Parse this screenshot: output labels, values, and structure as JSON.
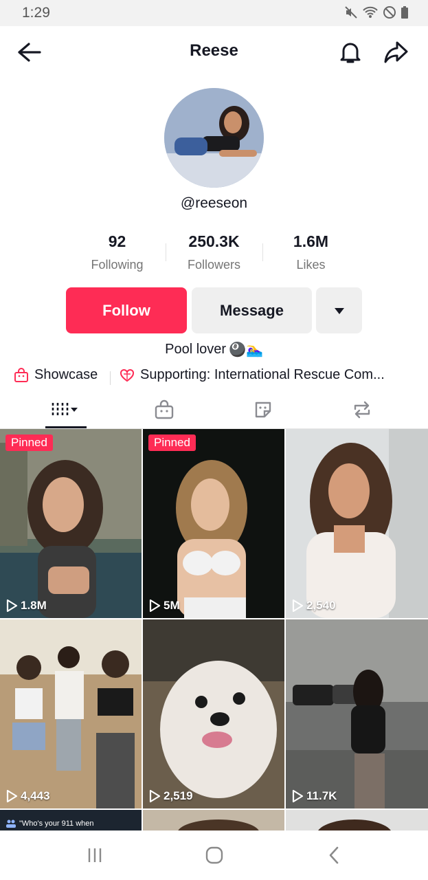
{
  "status_bar": {
    "time": "1:29",
    "icons": [
      "mute-icon",
      "wifi-icon",
      "do-not-disturb-icon",
      "battery-icon"
    ]
  },
  "header": {
    "title": "Reese",
    "icons": [
      "back-arrow-icon",
      "bell-icon",
      "share-icon"
    ]
  },
  "profile": {
    "username": "@reeseon",
    "stats": [
      {
        "value": "92",
        "label": "Following"
      },
      {
        "value": "250.3K",
        "label": "Followers"
      },
      {
        "value": "1.6M",
        "label": "Likes"
      }
    ],
    "follow_label": "Follow",
    "message_label": "Message",
    "bio": "Pool lover",
    "bio_emoji": "🎱🏊‍♀️",
    "links": [
      {
        "icon": "shop-bag-icon",
        "label": "Showcase"
      },
      {
        "icon": "heart-globe-icon",
        "label": "Supporting: International Rescue Com..."
      }
    ]
  },
  "tabs": [
    {
      "icon": "videos-grid-icon",
      "active": true
    },
    {
      "icon": "shop-bag-icon",
      "active": false
    },
    {
      "icon": "sticker-icon",
      "active": false
    },
    {
      "icon": "repost-icon",
      "active": false
    }
  ],
  "videos": [
    {
      "pinned": "Pinned",
      "plays": "1.8M"
    },
    {
      "pinned": "Pinned",
      "plays": "5M"
    },
    {
      "pinned": "",
      "plays": "2,540"
    },
    {
      "pinned": "",
      "plays": "4,443"
    },
    {
      "pinned": "",
      "plays": "2,519"
    },
    {
      "pinned": "",
      "plays": "11.7K"
    }
  ],
  "partial_row": {
    "caption": "\"Who's your 911 when"
  },
  "nav_bar": {
    "icons": [
      "recent-apps-icon",
      "home-icon",
      "back-icon"
    ]
  },
  "colors": {
    "accent": "#fe2c55",
    "button_secondary": "#efefef",
    "text_primary": "#161823",
    "text_secondary": "#757575"
  }
}
